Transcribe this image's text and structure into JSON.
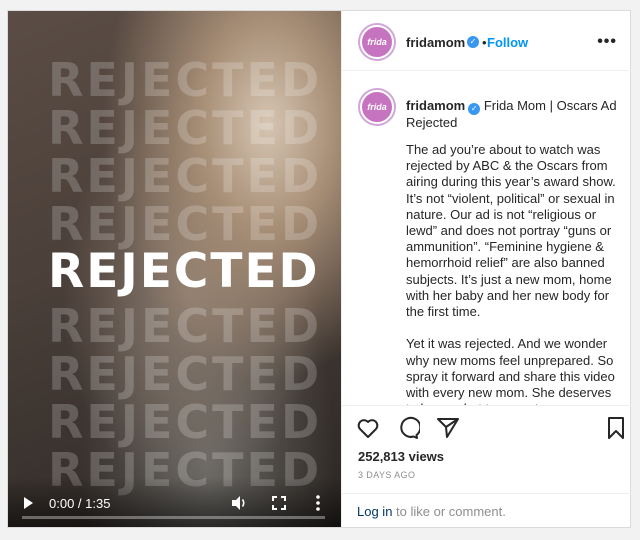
{
  "video": {
    "overlay_text": "REJECTED",
    "time": "0:00 / 1:35",
    "progress": 0
  },
  "header": {
    "username": "fridamom",
    "separator": "•",
    "follow_label": "Follow",
    "avatar_text": "frida"
  },
  "caption": {
    "username": "fridamom",
    "title": "Frida Mom | Oscars Ad Rejected",
    "body": "The ad you’re about to watch was rejected by ABC & the Oscars from airing during this year’s award show. It’s not “violent, political” or sexual in nature. Our ad is not “religious or lewd” and does not portray “guns or ammunition”. “Feminine hygiene & hemorrhoid relief” are also banned subjects. It’s just a new mom, home with her baby and her new body for the first time.\n\nYet it was rejected. And we wonder why new moms feel unprepared. So spray it forward and share this video with every new mom. She deserves to know what to expect."
  },
  "stats": {
    "views": "252,813 views",
    "posted": "3 DAYS AGO"
  },
  "login": {
    "link": "Log in",
    "rest": " to like or comment."
  },
  "colors": {
    "follow": "#0095f6",
    "verified": "#3897f0",
    "avatar": "#c774c0"
  },
  "icons": [
    "play-icon",
    "volume-icon",
    "fullscreen-icon",
    "more-vertical-icon",
    "more-horizontal-icon",
    "heart-icon",
    "comment-icon",
    "share-icon",
    "bookmark-icon",
    "verified-icon"
  ]
}
